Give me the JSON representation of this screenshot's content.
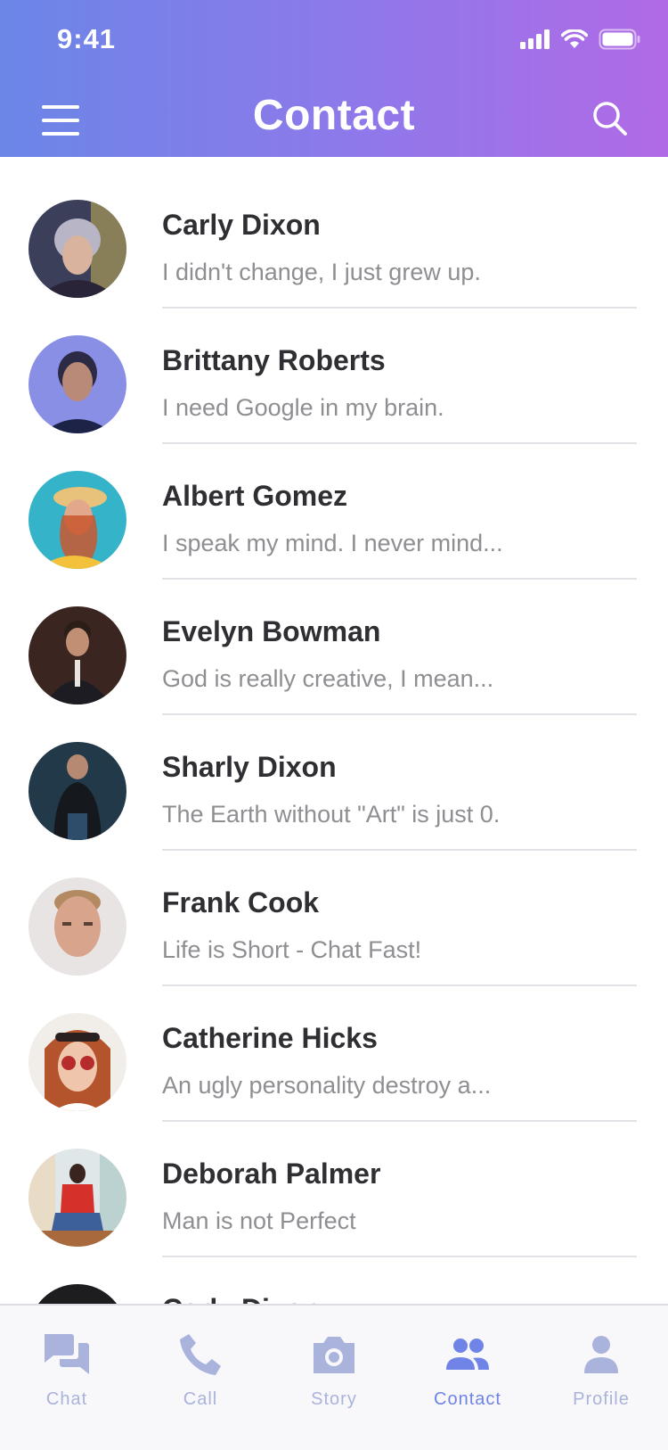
{
  "status_bar": {
    "time": "9:41"
  },
  "header": {
    "title": "Contact"
  },
  "contacts": [
    {
      "name": "Carly Dixon",
      "message": "I didn't change, I just grew up."
    },
    {
      "name": "Brittany Roberts",
      "message": "I need Google in my brain."
    },
    {
      "name": "Albert Gomez",
      "message": "I speak my mind. I never mind..."
    },
    {
      "name": "Evelyn Bowman",
      "message": "God is really creative, I mean..."
    },
    {
      "name": "Sharly Dixon",
      "message": "The Earth without \"Art\" is just 0."
    },
    {
      "name": "Frank Cook",
      "message": "Life is Short - Chat Fast!"
    },
    {
      "name": "Catherine Hicks",
      "message": "An ugly personality destroy a..."
    },
    {
      "name": "Deborah Palmer",
      "message": "Man is not Perfect"
    },
    {
      "name": "Carly Dixon",
      "message": ""
    }
  ],
  "tabs": [
    {
      "label": "Chat",
      "icon": "chat-icon"
    },
    {
      "label": "Call",
      "icon": "phone-icon"
    },
    {
      "label": "Story",
      "icon": "camera-icon"
    },
    {
      "label": "Contact",
      "icon": "contacts-icon",
      "active": true
    },
    {
      "label": "Profile",
      "icon": "profile-icon"
    }
  ],
  "colors": {
    "accent": "#6f84e6",
    "tab_inactive": "#a9b3db",
    "gradient_start": "#6b86e8",
    "gradient_end": "#b16ae6"
  }
}
